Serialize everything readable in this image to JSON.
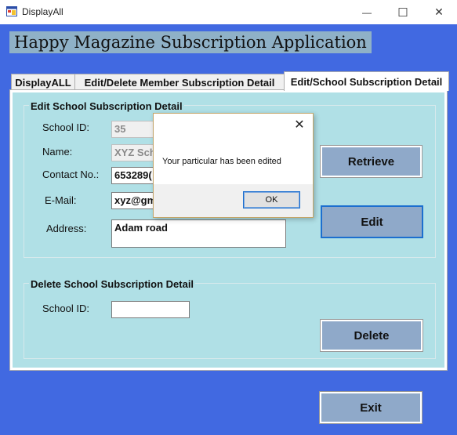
{
  "window": {
    "title": "DisplayAll",
    "minimize_glyph": "—",
    "maximize_glyph": "☐",
    "close_glyph": "✕"
  },
  "app_title": "Happy Magazine Subscription Application",
  "tabs": [
    {
      "label": "DisplayALL",
      "active": false
    },
    {
      "label": "Edit/Delete Member Subscription Detail",
      "active": false
    },
    {
      "label": "Edit/School Subscription Detail",
      "active": true
    }
  ],
  "edit_group": {
    "title": "Edit School Subscription Detail",
    "school_id_label": "School ID:",
    "school_id_value": "35",
    "name_label": "Name:",
    "name_value": "XYZ Sch",
    "contact_label": "Contact No.:",
    "contact_value": "653289(",
    "email_label": "E-Mail:",
    "email_value": "xyz@gm",
    "address_label": "Address:",
    "address_value": "Adam road",
    "retrieve_label": "Retrieve",
    "edit_label": "Edit"
  },
  "delete_group": {
    "title": "Delete School Subscription Detail",
    "school_id_label": "School ID:",
    "school_id_value": "",
    "delete_label": "Delete"
  },
  "exit_label": "Exit",
  "dialog": {
    "message": "Your particular has been edited",
    "ok_label": "OK",
    "close_glyph": "✕"
  },
  "colors": {
    "client_bg": "#4169e1",
    "tab_panel_bg": "#b0e0e6",
    "button_bg": "#8fa9c9",
    "title_label_bg": "#8fb1c7"
  },
  "icons": {
    "app": "window-app-icon"
  }
}
